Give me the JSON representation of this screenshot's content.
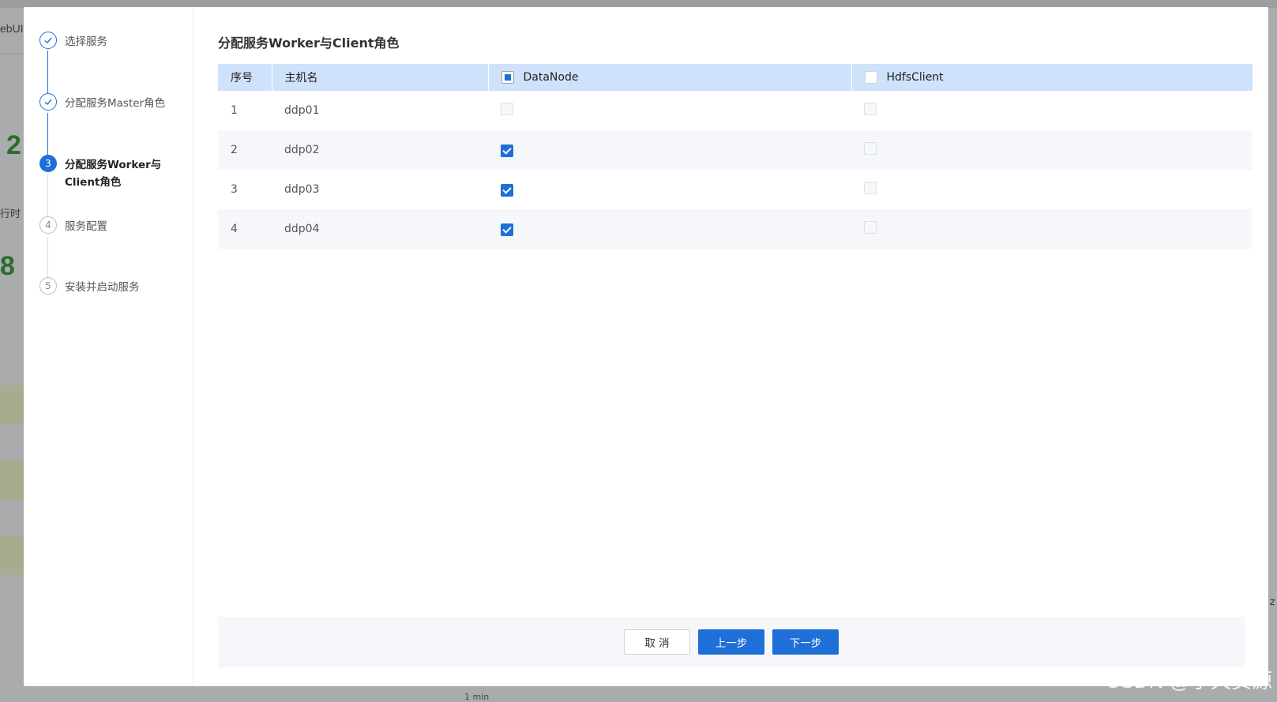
{
  "background": {
    "tab_fragment": "ebUI",
    "metric_a": "2",
    "metric_b": "8",
    "label_fragment": "行时",
    "axis_label": "1 min",
    "z_fragment": "z"
  },
  "steps": [
    {
      "label": "选择服务",
      "status": "done",
      "icon": "check-icon"
    },
    {
      "label": "分配服务Master角色",
      "status": "done",
      "icon": "check-icon"
    },
    {
      "label": "分配服务Worker与Client角色",
      "status": "active",
      "number": "3"
    },
    {
      "label": "服务配置",
      "status": "pending",
      "number": "4"
    },
    {
      "label": "安装并启动服务",
      "status": "pending",
      "number": "5"
    }
  ],
  "content": {
    "title": "分配服务Worker与Client角色",
    "columns": {
      "index": "序号",
      "host": "主机名",
      "datanode": "DataNode",
      "hdfsclient": "HdfsClient"
    },
    "header_checks": {
      "datanode": "indeterminate",
      "hdfsclient": "unchecked"
    },
    "rows": [
      {
        "index": "1",
        "host": "ddp01",
        "datanode": false,
        "datanode_disabled": true,
        "hdfsclient": false
      },
      {
        "index": "2",
        "host": "ddp02",
        "datanode": true,
        "datanode_disabled": false,
        "hdfsclient": false
      },
      {
        "index": "3",
        "host": "ddp03",
        "datanode": true,
        "datanode_disabled": false,
        "hdfsclient": false
      },
      {
        "index": "4",
        "host": "ddp04",
        "datanode": true,
        "datanode_disabled": false,
        "hdfsclient": false
      }
    ]
  },
  "footer": {
    "cancel": "取 消",
    "prev": "上一步",
    "next": "下一步"
  },
  "watermark": "CSDN @小天资源",
  "colors": {
    "primary": "#1f6fd8",
    "header_bg": "#cfe2fb"
  }
}
